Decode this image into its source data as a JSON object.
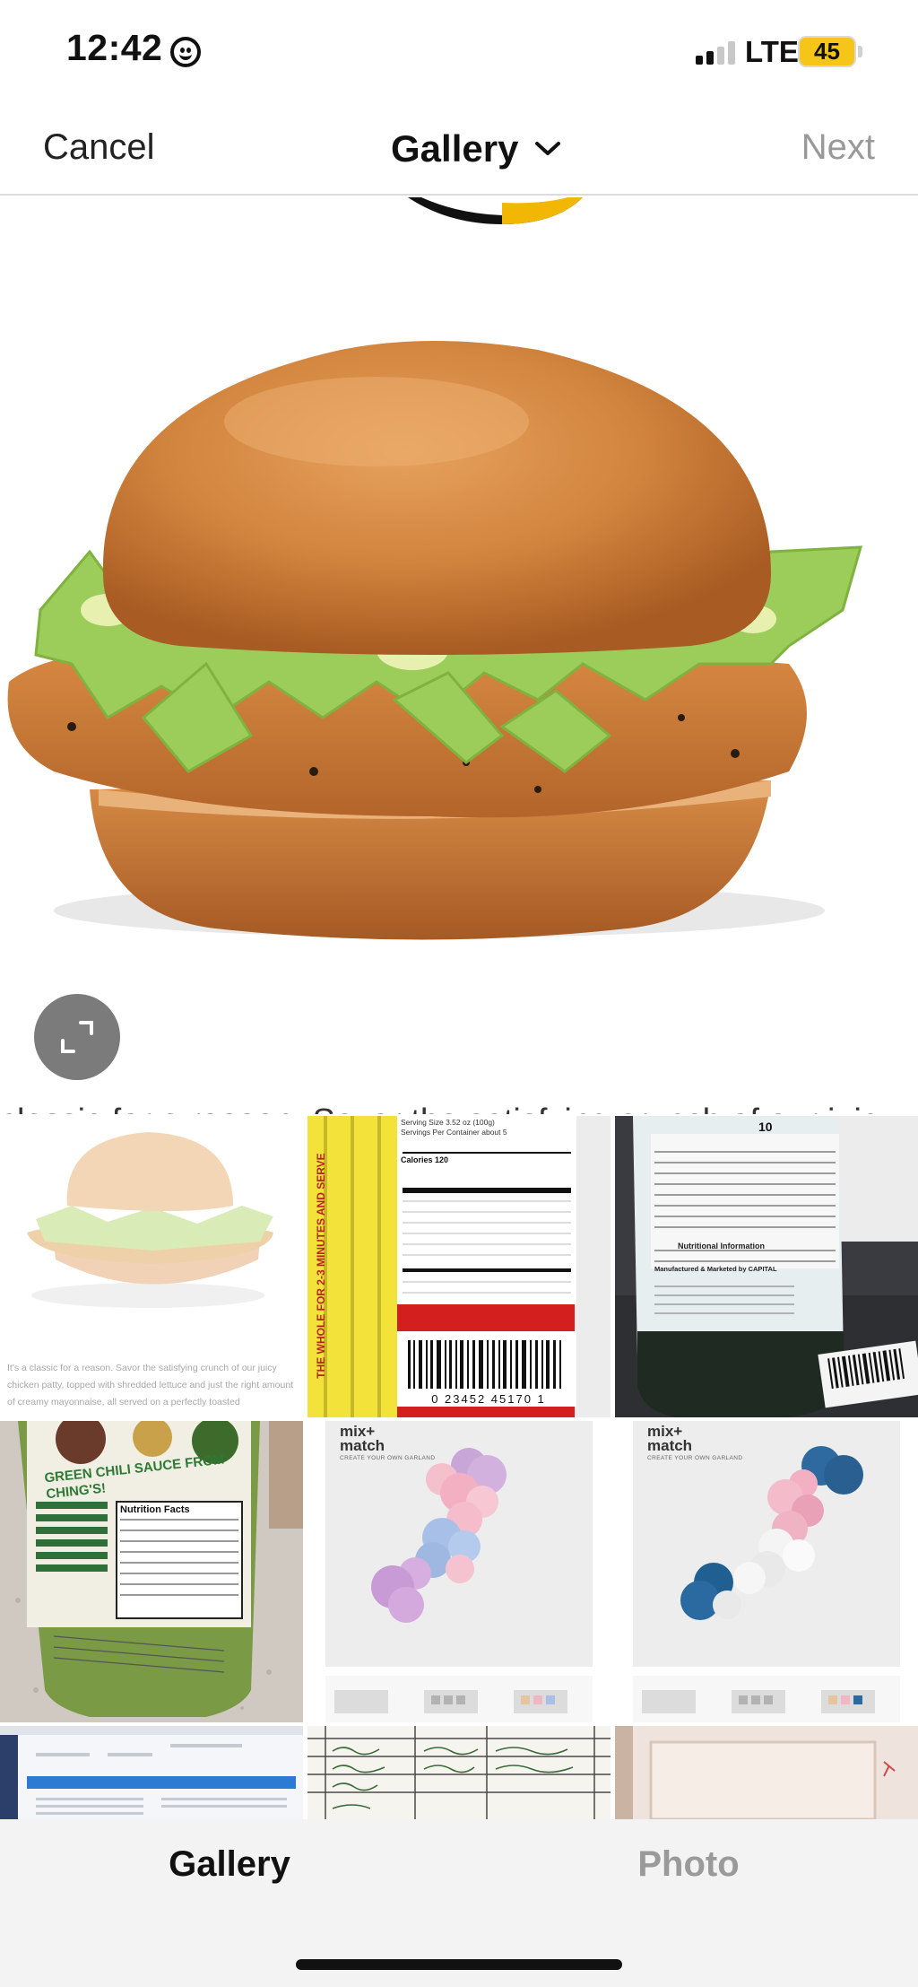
{
  "status_bar": {
    "time": "12:42",
    "network": "LTE",
    "battery": "45",
    "icons": [
      "smiley-face-icon",
      "signal-bars-icon",
      "battery-icon"
    ]
  },
  "nav": {
    "cancel_label": "Cancel",
    "title": "Gallery",
    "next_label": "Next",
    "next_enabled": false
  },
  "preview": {
    "subject": "chicken sandwich product photo",
    "caption_fragment": "classic for a reason. Savor the satisfying crunch of our juicy",
    "expand_icon": "expand-crop-icon"
  },
  "grid": {
    "thumb0": {
      "caption": "It's a classic for a reason. Savor the satisfying crunch of our juicy chicken patty, topped with shredded lettuce and just the right amount of creamy mayonnaise, all served on a perfectly toasted"
    },
    "thumb1": {
      "serving_size": "Serving Size 3.52 oz (100g)",
      "servings": "Servings Per Container about 5",
      "calories": "Calories 120",
      "barcode": "0 23452 45170 1",
      "side_text": "THE WHOLE FOR 2-3 MINUTES AND SERVE"
    },
    "thumb2": {
      "calories_value": "10",
      "panel_title": "Nutritional Information",
      "marketed_by": "Manufactured & Marketed by CAPITAL"
    },
    "thumb3": {
      "headline": "GREEN CHILI SAUCE FROM CHING'S!",
      "panel_title": "Nutrition Facts"
    },
    "thumb4": {
      "brand": "mix+ match",
      "tagline": "CREATE YOUR OWN GARLAND"
    },
    "thumb5": {
      "brand": "mix+ match",
      "tagline": "CREATE YOUR OWN GARLAND"
    }
  },
  "tabs": {
    "gallery_label": "Gallery",
    "photo_label": "Photo",
    "active": "Gallery"
  },
  "colors": {
    "battery": "#f5c518",
    "inactive_text": "#9a9a9a",
    "tabbar_bg": "#f3f3f3"
  }
}
